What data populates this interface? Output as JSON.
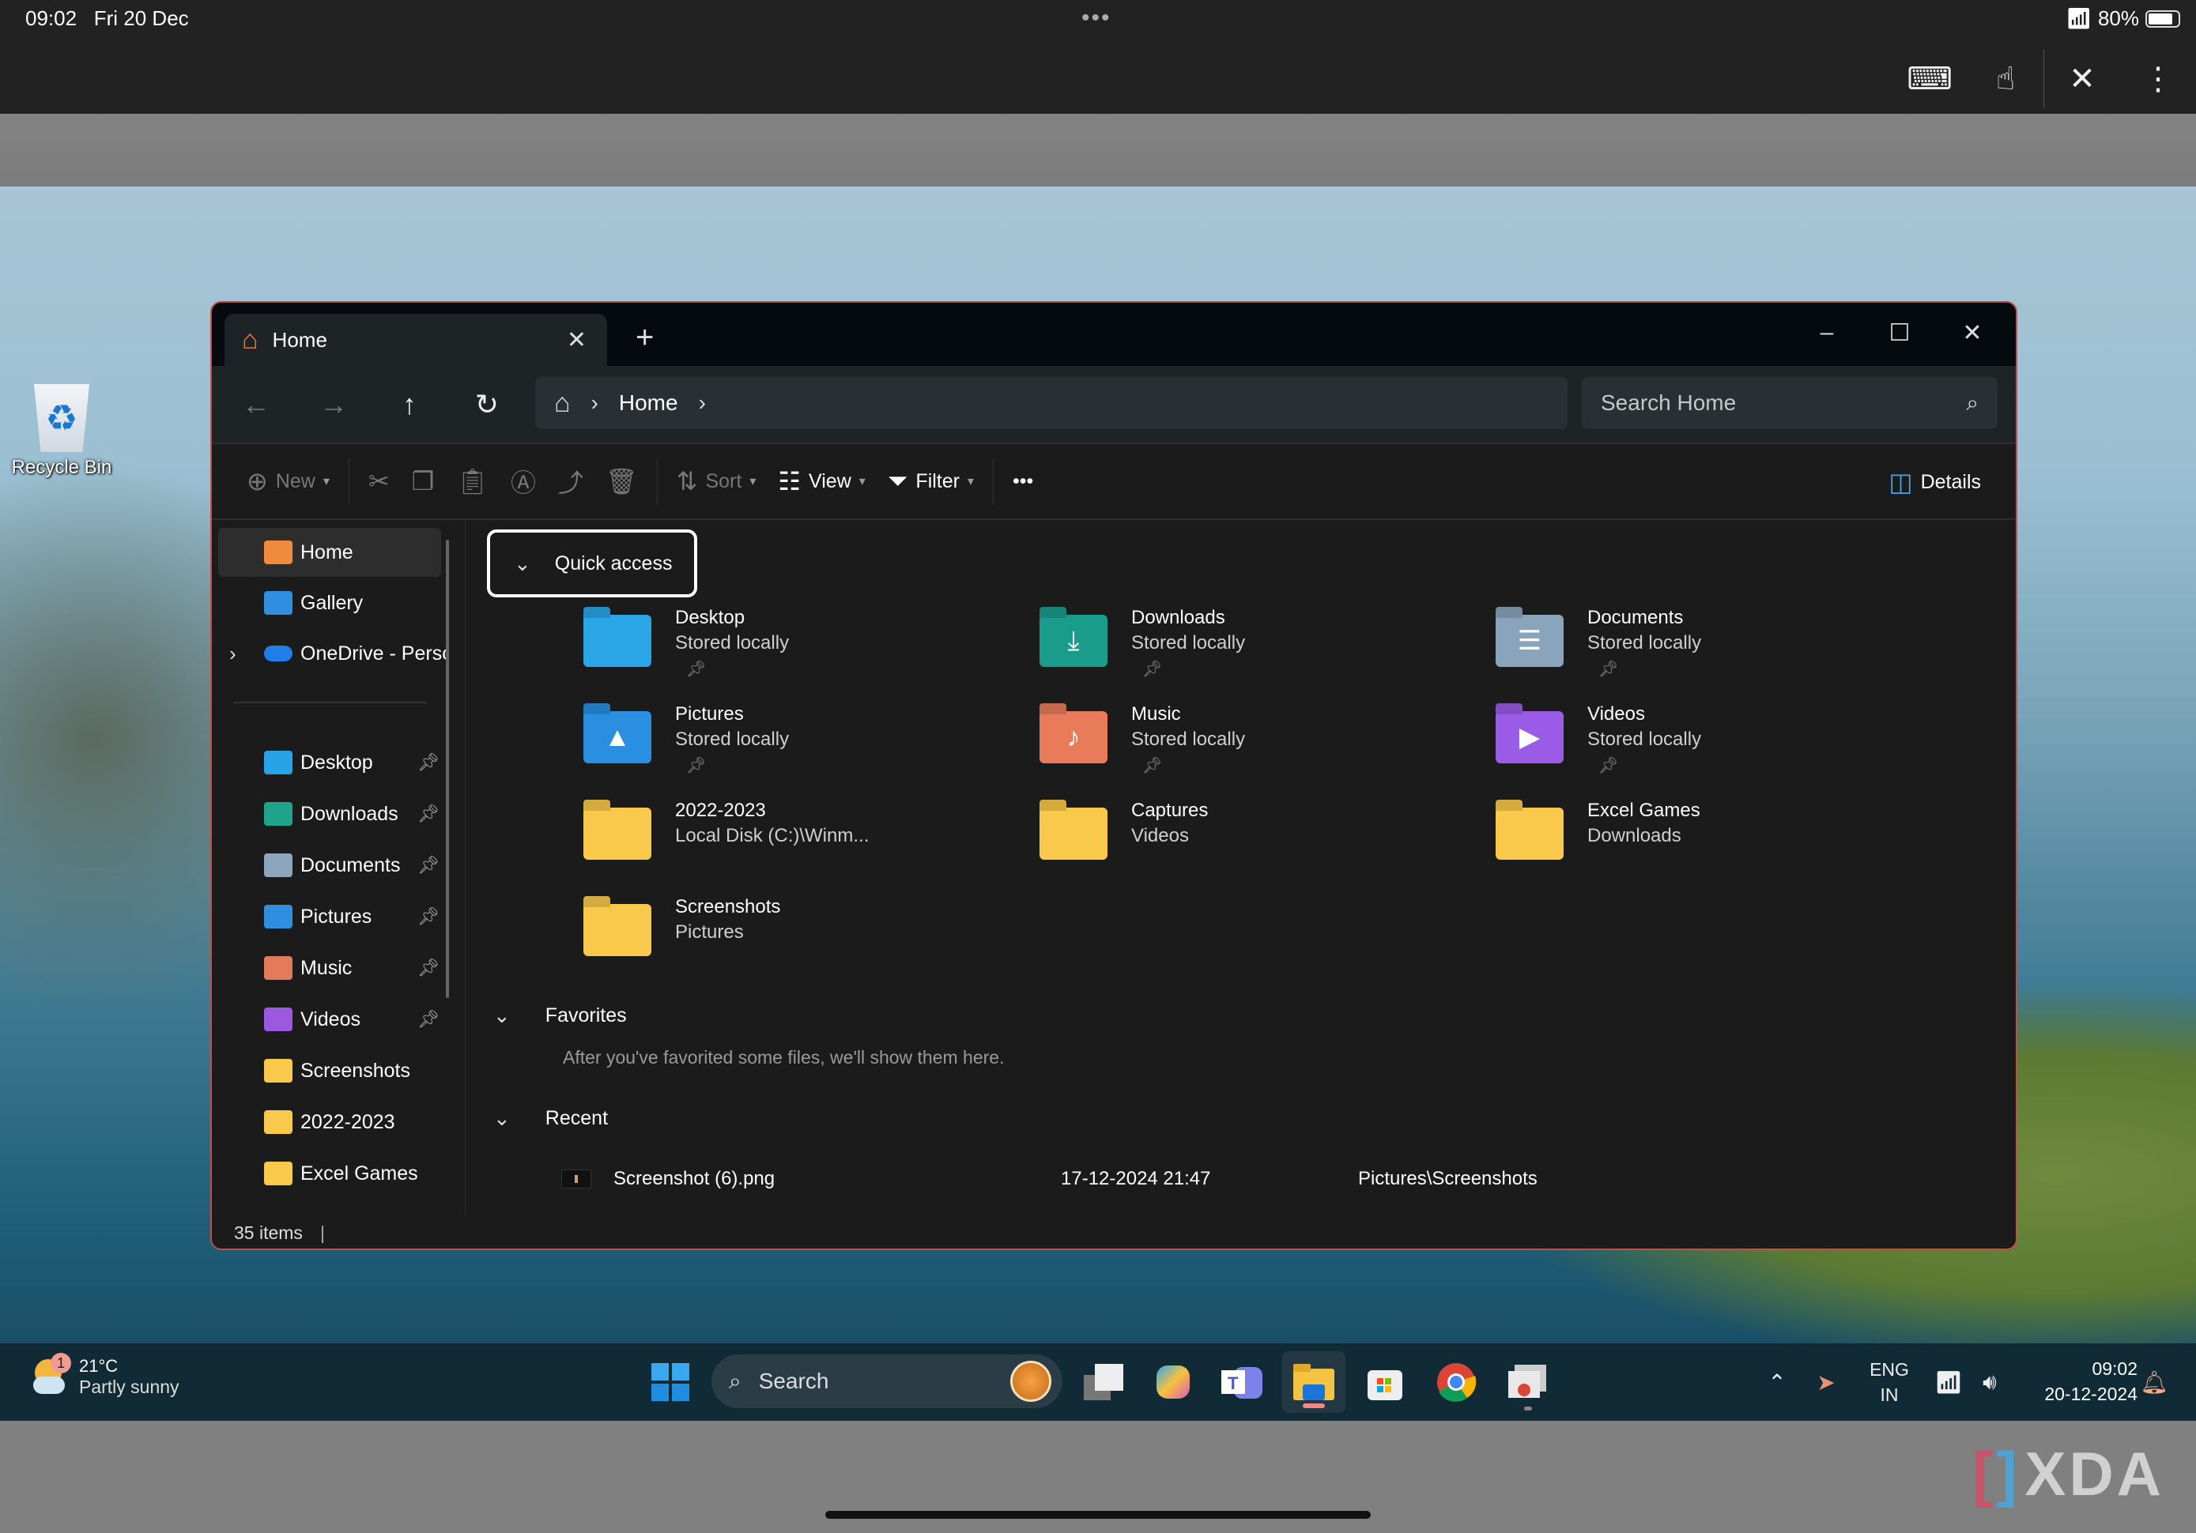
{
  "ipad_status": {
    "time": "09:02",
    "date": "Fri 20 Dec",
    "battery": "80%"
  },
  "ipad_tools": [
    {
      "name": "keyboard-icon",
      "glyph": "⌨"
    },
    {
      "name": "touch-icon",
      "glyph": "☝"
    },
    {
      "name": "unpin-icon",
      "glyph": "✕"
    },
    {
      "name": "more-icon",
      "glyph": "⋮"
    }
  ],
  "desktop": {
    "recycle_bin_label": "Recycle Bin"
  },
  "explorer": {
    "tab": {
      "title": "Home"
    },
    "window_controls": {
      "minimize": "–",
      "maximize": "☐",
      "close": "✕"
    },
    "nav": {
      "back": "←",
      "forward": "→",
      "up": "↑",
      "refresh": "↻"
    },
    "breadcrumb": {
      "home_glyph": "⌂",
      "items": [
        "Home"
      ]
    },
    "search": {
      "placeholder": "Search Home"
    },
    "toolbar": {
      "new": "New",
      "sort": "Sort",
      "view": "View",
      "filter": "Filter",
      "more": "•••",
      "details": "Details"
    },
    "sidebar": {
      "top": [
        {
          "label": "Home",
          "color": "#f08a3c",
          "active": true
        },
        {
          "label": "Gallery",
          "color": "#2f8ee0"
        },
        {
          "label": "OneDrive - Personal",
          "color": "#1f7ee8",
          "expandable": true
        }
      ],
      "pinned": [
        {
          "label": "Desktop",
          "color": "#29a3e8",
          "pinned": true
        },
        {
          "label": "Downloads",
          "color": "#1fa38b",
          "pinned": true
        },
        {
          "label": "Documents",
          "color": "#8da5bd",
          "pinned": true
        },
        {
          "label": "Pictures",
          "color": "#2f8ee0",
          "pinned": true
        },
        {
          "label": "Music",
          "color": "#e37a5a",
          "pinned": true
        },
        {
          "label": "Videos",
          "color": "#9b59e0",
          "pinned": true
        },
        {
          "label": "Screenshots",
          "color": "#f8c94a"
        },
        {
          "label": "2022-2023",
          "color": "#f8c94a"
        },
        {
          "label": "Excel Games",
          "color": "#f8c94a"
        }
      ]
    },
    "quick_access": {
      "header": "Quick access",
      "items": [
        {
          "name": "Desktop",
          "sub": "Stored locally",
          "pinned": true,
          "color": "#2aa5e6",
          "glyph": ""
        },
        {
          "name": "Downloads",
          "sub": "Stored locally",
          "pinned": true,
          "color": "#1a9c8c",
          "glyph": "⤓"
        },
        {
          "name": "Documents",
          "sub": "Stored locally",
          "pinned": true,
          "color": "#8aa4bc",
          "glyph": "☰"
        },
        {
          "name": "Pictures",
          "sub": "Stored locally",
          "pinned": true,
          "color": "#2a8fe0",
          "glyph": "▲"
        },
        {
          "name": "Music",
          "sub": "Stored locally",
          "pinned": true,
          "color": "#e87c5a",
          "glyph": "♪"
        },
        {
          "name": "Videos",
          "sub": "Stored locally",
          "pinned": true,
          "color": "#9a5ce6",
          "glyph": "▶"
        },
        {
          "name": "2022-2023",
          "sub": "Local Disk (C:)\\Winm...",
          "pinned": false,
          "color": "#f8c94a",
          "glyph": ""
        },
        {
          "name": "Captures",
          "sub": "Videos",
          "pinned": false,
          "color": "#f8c94a",
          "glyph": ""
        },
        {
          "name": "Excel Games",
          "sub": "Downloads",
          "pinned": false,
          "color": "#f8c94a",
          "glyph": ""
        },
        {
          "name": "Screenshots",
          "sub": "Pictures",
          "pinned": false,
          "color": "#f8c94a",
          "glyph": ""
        }
      ]
    },
    "favorites": {
      "header": "Favorites",
      "empty_text": "After you've favorited some files, we'll show them here."
    },
    "recent": {
      "header": "Recent",
      "items": [
        {
          "name": "Screenshot (6).png",
          "date": "17-12-2024 21:47",
          "location": "Pictures\\Screenshots"
        }
      ]
    },
    "status": {
      "items_count": "35 items"
    }
  },
  "taskbar": {
    "weather": {
      "temp": "21°C",
      "condition": "Partly sunny",
      "badge": "1"
    },
    "search_label": "Search",
    "apps": [
      "start",
      "task-view",
      "copilot",
      "teams",
      "file-explorer",
      "store",
      "chrome",
      "chrome-window"
    ],
    "tray": {
      "lang_1": "ENG",
      "lang_2": "IN",
      "time": "09:02",
      "date": "20-12-2024"
    }
  },
  "watermark": "XDA"
}
